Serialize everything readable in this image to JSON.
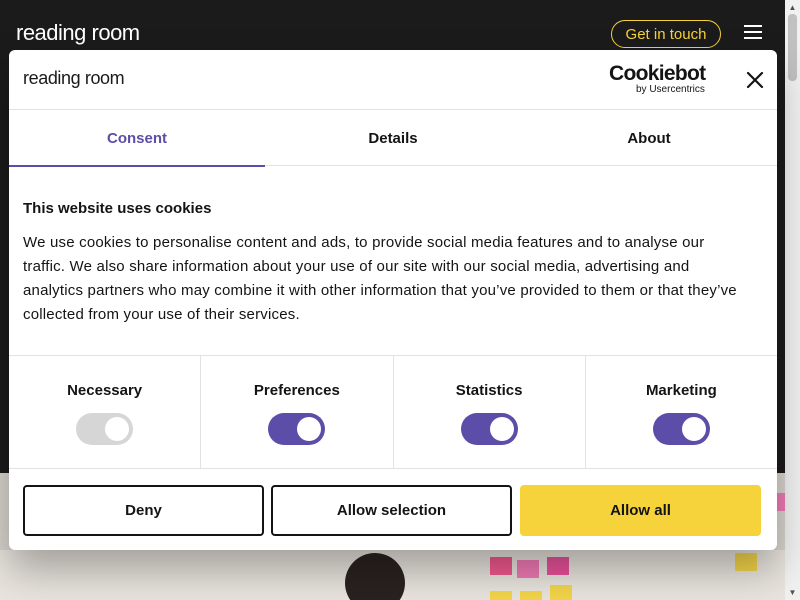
{
  "site": {
    "logo": "reading room",
    "cta_label": "Get in touch"
  },
  "dialog": {
    "logo": "reading room",
    "cookiebot": {
      "brand": "Cookiebot",
      "sub": "by Usercentrics"
    },
    "tabs": [
      {
        "label": "Consent",
        "active": true
      },
      {
        "label": "Details",
        "active": false
      },
      {
        "label": "About",
        "active": false
      }
    ],
    "title": "This website uses cookies",
    "text": "We use cookies to personalise content and ads, to provide social media features and to analyse our traffic. We also share information about your use of our site with our social media, advertising and analytics partners who may combine it with other information that you’ve provided to them or that they’ve collected from your use of their services.",
    "toggles": [
      {
        "label": "Necessary",
        "state": "disabled-on"
      },
      {
        "label": "Preferences",
        "state": "on"
      },
      {
        "label": "Statistics",
        "state": "on"
      },
      {
        "label": "Marketing",
        "state": "on"
      }
    ],
    "buttons": {
      "deny": "Deny",
      "allow_selection": "Allow selection",
      "allow_all": "Allow all"
    }
  },
  "colors": {
    "accent": "#5c4ea8",
    "cta_yellow": "#f6d33a",
    "header_bg": "#1b1b1b"
  }
}
